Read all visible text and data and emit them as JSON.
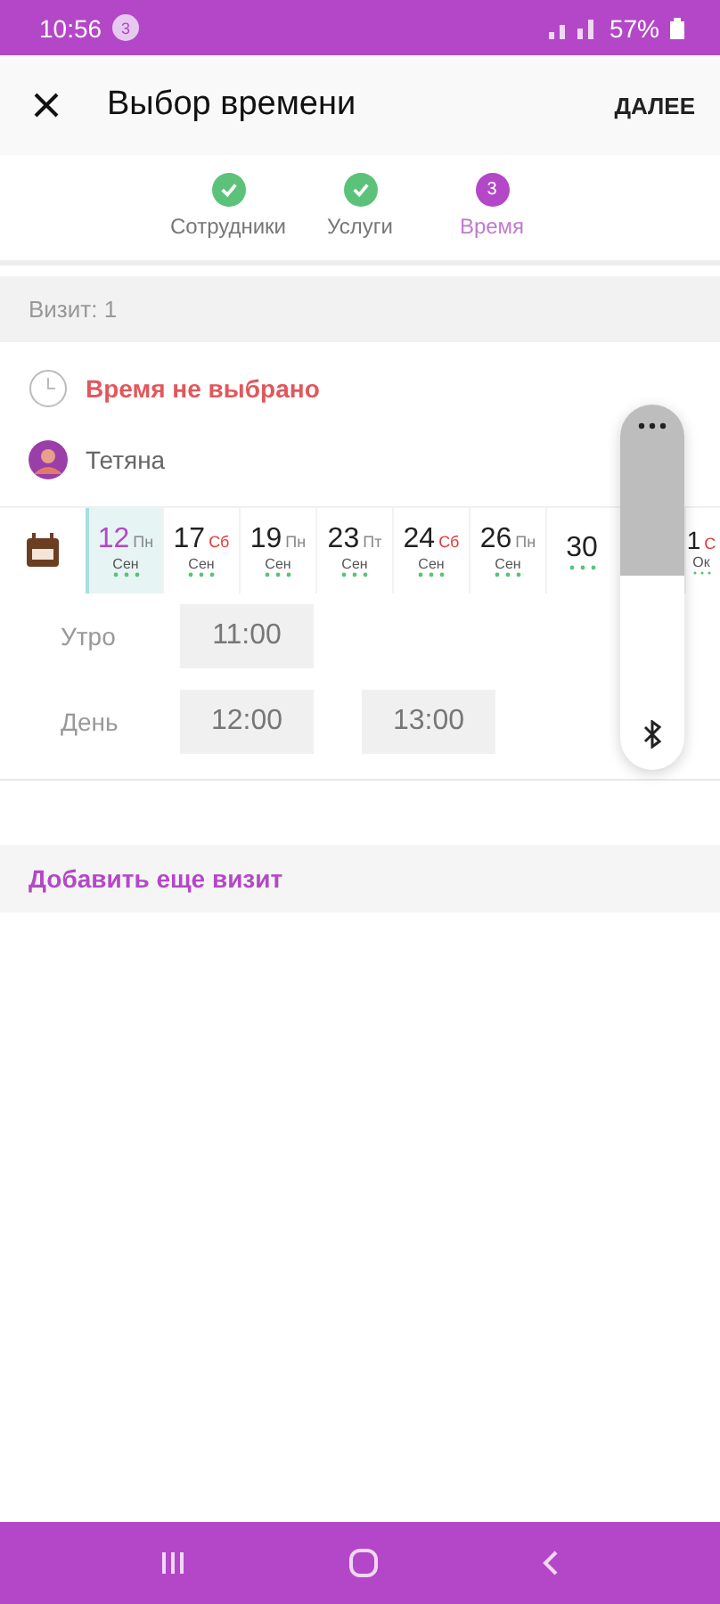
{
  "status_bar": {
    "time": "10:56",
    "badge": "3",
    "battery": "57%"
  },
  "app_bar": {
    "title": "Выбор времени",
    "action": "ДАЛЕЕ"
  },
  "stepper": [
    {
      "label": "Сотрудники",
      "completed": true,
      "selected": false
    },
    {
      "label": "Услуги",
      "completed": true,
      "selected": false
    },
    {
      "label": "Время",
      "completed": false,
      "selected": true,
      "number": "3"
    }
  ],
  "visit": {
    "header": "Визит: 1",
    "status": "Время не выбрано",
    "employee": "Тетяна"
  },
  "dates": [
    {
      "day": "12",
      "weekday": "Пн",
      "month": "Сен",
      "weekend": false,
      "selected": true
    },
    {
      "day": "17",
      "weekday": "Сб",
      "month": "Сен",
      "weekend": true,
      "selected": false
    },
    {
      "day": "19",
      "weekday": "Пн",
      "month": "Сен",
      "weekend": false,
      "selected": false
    },
    {
      "day": "23",
      "weekday": "Пт",
      "month": "Сен",
      "weekend": false,
      "selected": false
    },
    {
      "day": "24",
      "weekday": "Сб",
      "month": "Сен",
      "weekend": true,
      "selected": false
    },
    {
      "day": "26",
      "weekday": "Пн",
      "month": "Сен",
      "weekend": false,
      "selected": false
    },
    {
      "day": "30",
      "selected": false
    },
    {
      "day": "1",
      "weekday": "С",
      "month": "Ок",
      "weekend": true,
      "selected": false
    }
  ],
  "slots": [
    {
      "period": "Утро",
      "times": [
        "11:00"
      ]
    },
    {
      "period": "День",
      "times": [
        "12:00",
        "13:00"
      ]
    }
  ],
  "add_visit": "Добавить еще визит"
}
